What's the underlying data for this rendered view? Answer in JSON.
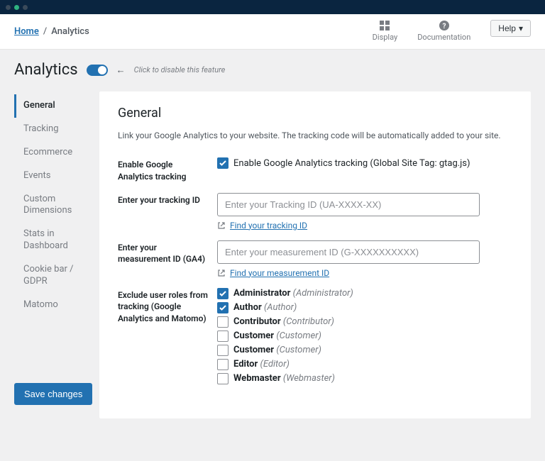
{
  "breadcrumb": {
    "home": "Home",
    "current": "Analytics"
  },
  "header": {
    "display": "Display",
    "documentation": "Documentation",
    "help": "Help"
  },
  "page_title": "Analytics",
  "toggle_hint": "Click to disable this feature",
  "sidebar": [
    "General",
    "Tracking",
    "Ecommerce",
    "Events",
    "Custom Dimensions",
    "Stats in Dashboard",
    "Cookie bar / GDPR",
    "Matomo"
  ],
  "panel": {
    "title": "General",
    "desc": "Link your Google Analytics to your website. The tracking code will be automatically added to your site."
  },
  "fields": {
    "enable": {
      "label": "Enable Google Analytics tracking",
      "text": "Enable Google Analytics tracking (Global Site Tag: gtag.js)",
      "checked": true
    },
    "tracking_id": {
      "label": "Enter your tracking ID",
      "placeholder": "Enter your Tracking ID (UA-XXXX-XX)",
      "link": "Find your tracking ID"
    },
    "measurement_id": {
      "label": "Enter your measurement ID (GA4)",
      "placeholder": "Enter your measurement ID (G-XXXXXXXXXX)",
      "link": "Find your measurement ID"
    },
    "roles": {
      "label": "Exclude user roles from tracking (Google Analytics and Matomo)",
      "items": [
        {
          "name": "Administrator",
          "slug": "Administrator",
          "checked": true
        },
        {
          "name": "Author",
          "slug": "Author",
          "checked": true
        },
        {
          "name": "Contributor",
          "slug": "Contributor",
          "checked": false
        },
        {
          "name": "Customer",
          "slug": "Customer",
          "checked": false
        },
        {
          "name": "Customer",
          "slug": "Customer",
          "checked": false
        },
        {
          "name": "Editor",
          "slug": "Editor",
          "checked": false
        },
        {
          "name": "Webmaster",
          "slug": "Webmaster",
          "checked": false
        }
      ]
    }
  },
  "save": "Save changes"
}
